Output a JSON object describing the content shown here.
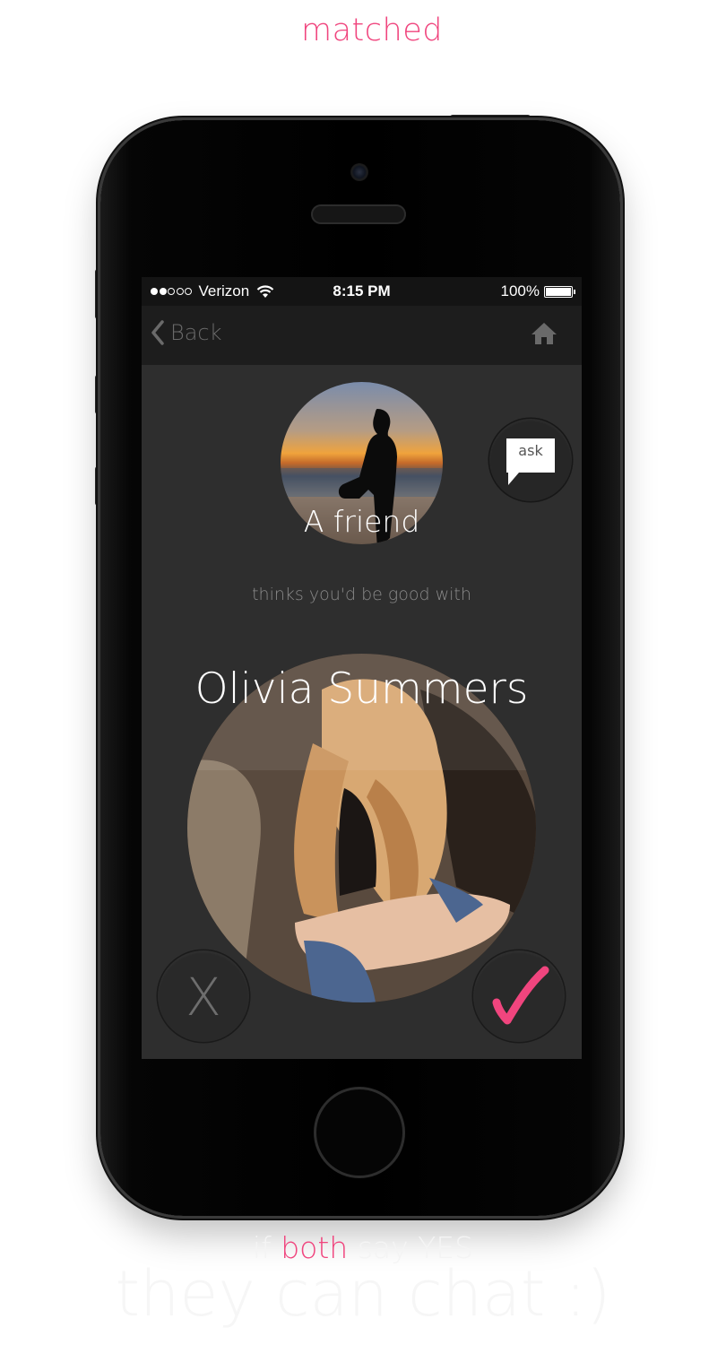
{
  "page": {
    "title": "matched",
    "footer_line1_prefix": "if",
    "footer_line1_highlight": "both",
    "footer_line1_suffix": "say YES",
    "footer_line2": "they can chat :)",
    "accent_color": "#f0457e"
  },
  "status_bar": {
    "carrier": "Verizon",
    "signal_dots": "●●○○○",
    "time": "8:15 PM",
    "battery": "100%",
    "icons": [
      "wifi-icon",
      "battery-icon"
    ]
  },
  "nav": {
    "back_label": "Back",
    "back_icon": "chevron-left-icon",
    "home_icon": "home-icon"
  },
  "match": {
    "friend_label": "A friend",
    "subtitle": "thinks you'd be good with",
    "ask_label": "ask",
    "name": "Olivia Summers",
    "reject_label": "X",
    "accept_icon": "checkmark-icon"
  }
}
